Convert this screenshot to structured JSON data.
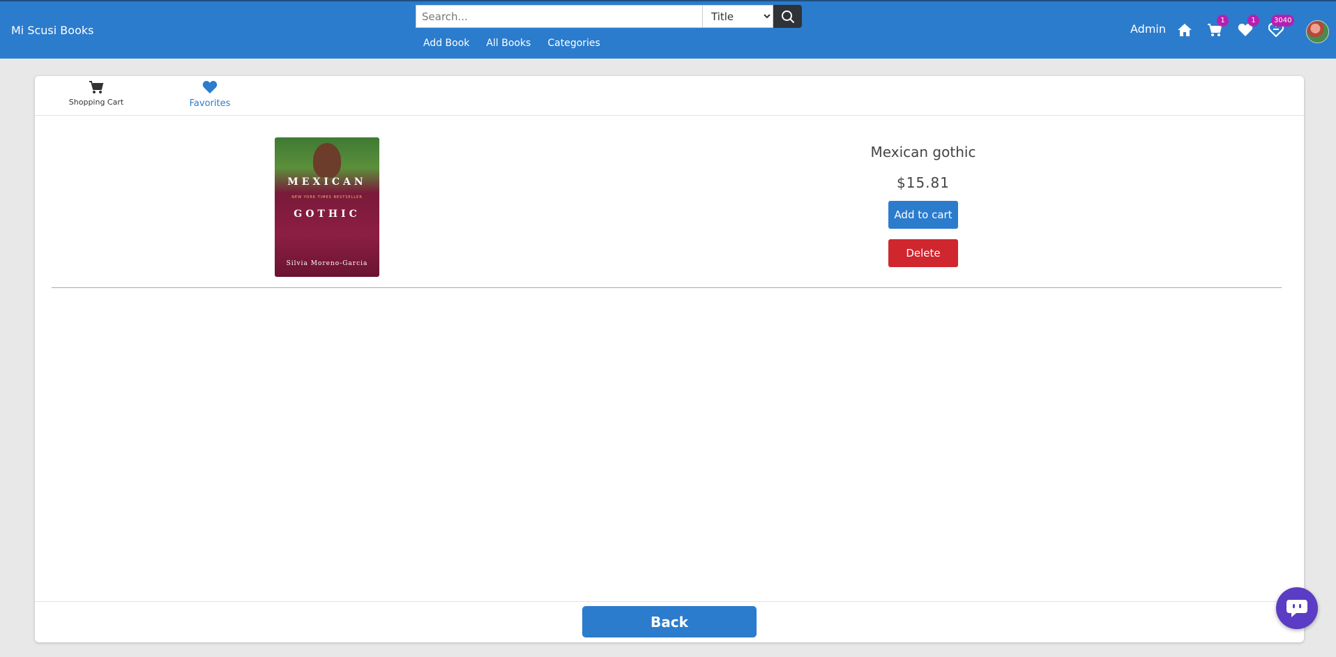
{
  "header": {
    "brand": "Mi Scusi Books",
    "search": {
      "placeholder": "Search...",
      "value": "",
      "field_selected": "Title"
    },
    "nav": [
      {
        "label": "Add Book"
      },
      {
        "label": "All Books"
      },
      {
        "label": "Categories"
      }
    ],
    "user_label": "Admin",
    "badges": {
      "cart": "1",
      "favorites": "1",
      "wishlist": "3040"
    },
    "icons": [
      "home-icon",
      "cart-icon",
      "heart-icon",
      "heart-list-icon"
    ]
  },
  "tabs": {
    "cart_label": "Shopping Cart",
    "favorites_label": "Favorites",
    "active": "favorites"
  },
  "favorites": [
    {
      "cover_title_line1": "MEXICAN",
      "cover_title_line2": "GOTHIC",
      "cover_tagline": "NEW YORK TIMES BESTSELLER",
      "cover_author": "Silvia Moreno-Garcia",
      "title": "Mexican gothic",
      "price": "$15.81",
      "add_label": "Add to cart",
      "delete_label": "Delete"
    }
  ],
  "footer": {
    "back_label": "Back"
  },
  "colors": {
    "primary": "#2b7ccd",
    "danger": "#d0262e",
    "badge": "#b620b0",
    "chat": "#5b3cc4"
  }
}
